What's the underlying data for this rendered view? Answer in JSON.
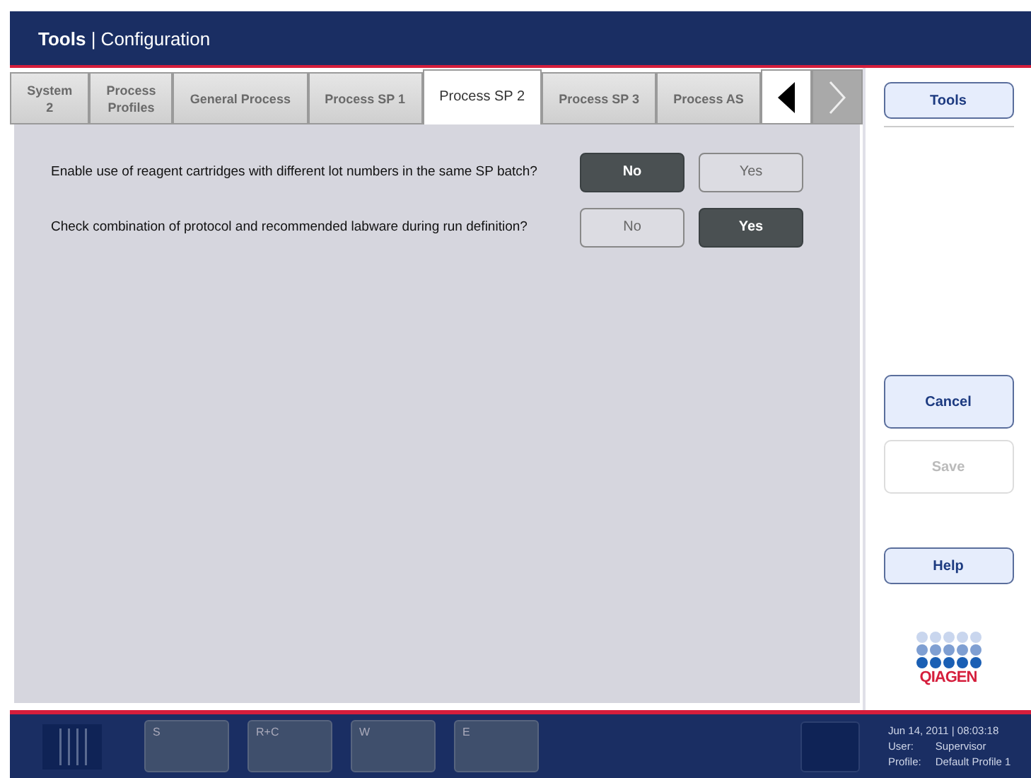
{
  "header": {
    "title": "**Tools** | Configuration"
  },
  "tabs": [
    {
      "label": "System\n2",
      "selected": false
    },
    {
      "label": "Process\nProfiles",
      "selected": false
    },
    {
      "label": "General Process",
      "selected": false
    },
    {
      "label": "Process SP 1",
      "selected": false
    },
    {
      "label": "Process SP 2",
      "selected": true
    },
    {
      "label": "Process SP 3",
      "selected": false
    },
    {
      "label": "Process AS",
      "selected": false
    }
  ],
  "tab_nav": {
    "previous_disabled": false,
    "next_disabled": true
  },
  "settings": [
    {
      "question": "Enable use of reagent cartridges with different lot numbers in the same SP batch?",
      "options": [
        {
          "label": "No",
          "selected": true
        },
        {
          "label": "Yes",
          "selected": false
        }
      ]
    },
    {
      "question": "Check combination of protocol and recommended labware during run definition?",
      "options": [
        {
          "label": "No",
          "selected": false
        },
        {
          "label": "Yes",
          "selected": true
        }
      ]
    }
  ],
  "side_buttons": [
    {
      "label": "Tools",
      "disabled": false,
      "kind": "top"
    },
    {
      "label": "Cancel",
      "disabled": false,
      "kind": "bottom"
    },
    {
      "label": "Save",
      "disabled": true,
      "kind": "bottom"
    },
    {
      "label": "Help",
      "disabled": false,
      "kind": "help"
    }
  ],
  "logo": {
    "text": "QIAGEN"
  },
  "slots": [
    "S",
    "R+C",
    "W",
    "E"
  ],
  "status": {
    "datetime": "Jun 14, 2011 | 08:03:18",
    "user_label": "User:",
    "user": "Supervisor",
    "profile_label": "Profile:",
    "profile": "Default Profile 1"
  }
}
